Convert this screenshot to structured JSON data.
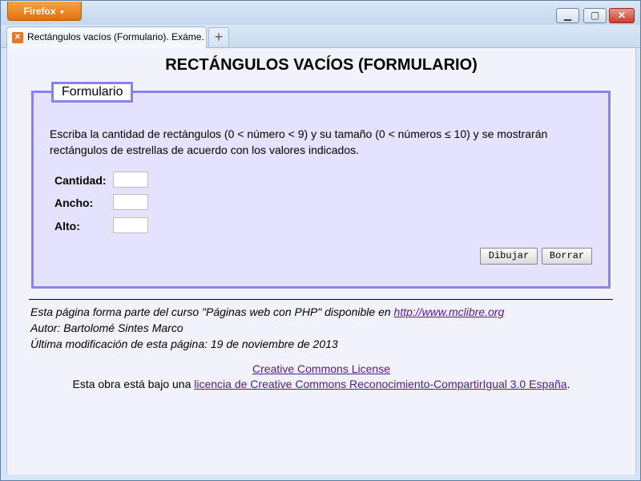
{
  "browser": {
    "menu_label": "Firefox",
    "tab_title": "Rectángulos vacíos (Formulario). Exáme...",
    "new_tab": "+",
    "controls": {
      "minimize": "▁",
      "maximize": "▢",
      "close": "✕"
    }
  },
  "page": {
    "heading": "RECTÁNGULOS VACÍOS (FORMULARIO)",
    "legend": "Formulario",
    "description": "Escriba la cantidad de rectángulos (0 < número < 9) y su tamaño (0 < números ≤ 10) y se mostrarán rectángulos de estrellas de acuerdo con los valores indicados.",
    "fields": [
      {
        "label": "Cantidad:",
        "value": ""
      },
      {
        "label": "Ancho:",
        "value": ""
      },
      {
        "label": "Alto:",
        "value": ""
      }
    ],
    "buttons": {
      "draw": "Dibujar",
      "clear": "Borrar"
    }
  },
  "footer": {
    "line1_text": "Esta página forma parte del curso \"Páginas web con PHP\" disponible en ",
    "line1_link": "http://www.mclibre.org",
    "line2": "Autor: Bartolomé Sintes Marco",
    "line3": "Última modificación de esta página: 19 de noviembre de 2013",
    "cc_link": "Creative Commons License",
    "license_prefix": "Esta obra está bajo una ",
    "license_link": "licencia de Creative Commons Reconocimiento-CompartirIgual 3.0 España",
    "license_suffix": "."
  },
  "colors": {
    "accent": "#8a84e6",
    "fieldset_bg": "#e4e2fc",
    "firefox_orange": "#e8742e",
    "link": "#551a8b"
  }
}
